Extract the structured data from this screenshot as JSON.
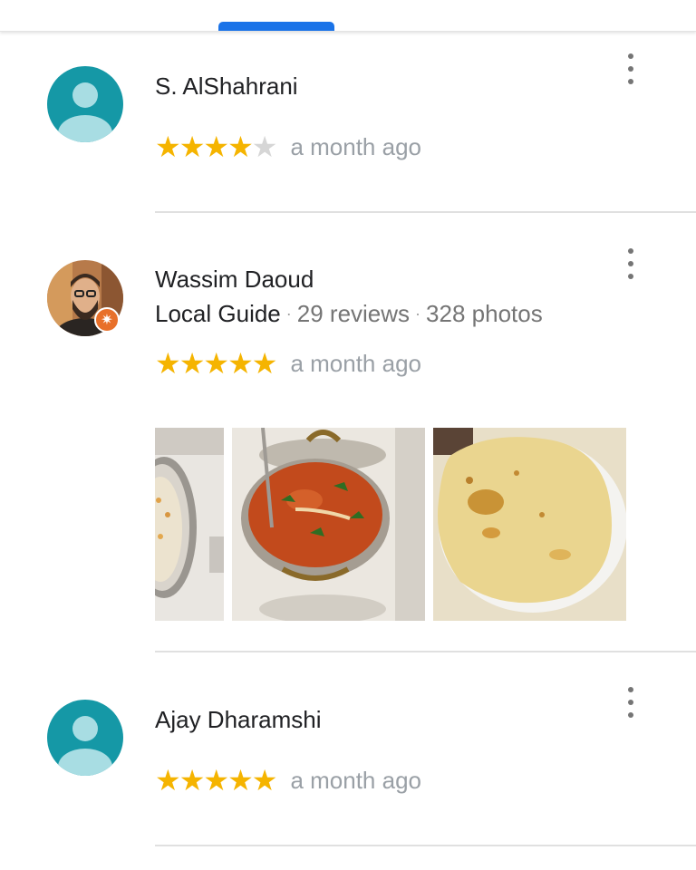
{
  "colors": {
    "accent": "#1a73e8",
    "star_filled": "#f5b400",
    "star_empty": "#d6d6d6",
    "avatar_teal": "#1598a6",
    "badge": "#e8702a"
  },
  "icons": {
    "star": "★",
    "more": "more-vert-icon",
    "guide_badge": "✷"
  },
  "reviews": [
    {
      "author": "S. AlShahrani",
      "rating": 4,
      "time": "a month ago"
    },
    {
      "author": "Wassim Daoud",
      "guide_label": "Local Guide",
      "reviews_count": "29 reviews",
      "photos_count": "328 photos",
      "separator": "·",
      "rating": 5,
      "time": "a month ago"
    },
    {
      "author": "Ajay Dharamshi",
      "rating": 5,
      "time": "a month ago"
    }
  ]
}
